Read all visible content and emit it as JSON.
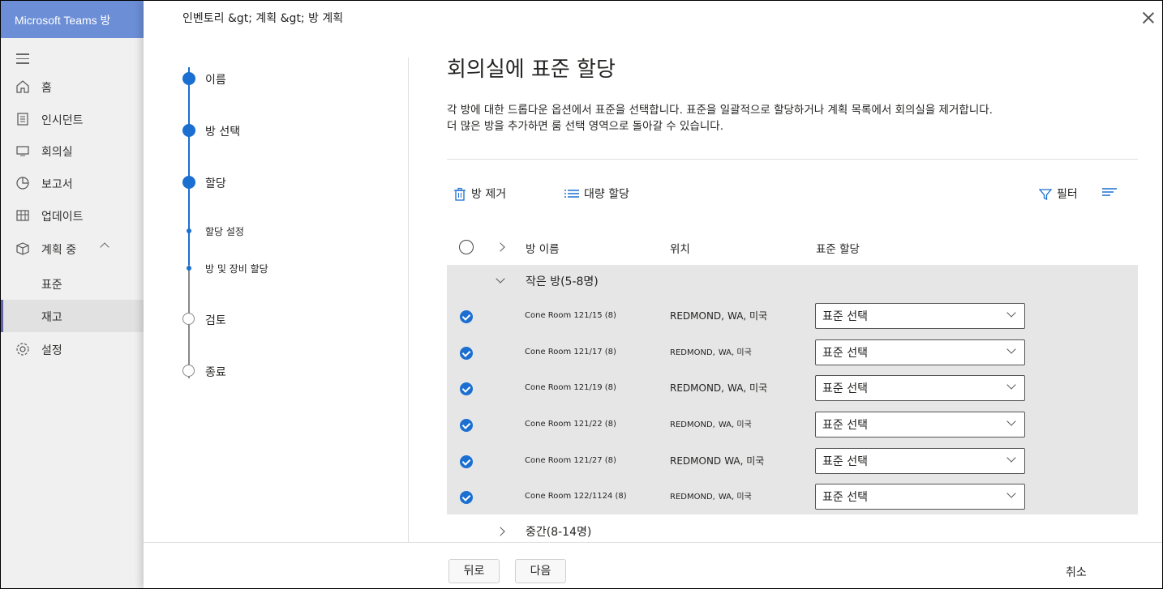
{
  "app": {
    "title": "Microsoft Teams 방",
    "nav": {
      "home": "홈",
      "incidents": "인시던트",
      "rooms": "회의실",
      "reports": "보고서",
      "updates": "업데이트",
      "planning": "계획 중",
      "standards": "표준",
      "inventory": "재고",
      "settings": "설정"
    }
  },
  "dialog": {
    "breadcrumb": "인벤토리 &gt; 계획 &gt;  방 계획",
    "steps": [
      {
        "label": "이름",
        "state": "done"
      },
      {
        "label": "방 선택",
        "state": "done"
      },
      {
        "label": "할당",
        "state": "current"
      },
      {
        "label": "할당 설정",
        "state": "sub"
      },
      {
        "label": "방 및 장비 할당",
        "state": "sub"
      },
      {
        "label": "검토",
        "state": "todo"
      },
      {
        "label": "종료",
        "state": "todo"
      }
    ],
    "heading": "회의실에 표준 할당",
    "description_line1": "각 방에 대한 드롭다운 옵션에서 표준을 선택합니다. 표준을 일괄적으로 할당하거나 계획 목록에서 회의실을 제거합니다.",
    "description_line2": "더 많은 방을 추가하면 룸 선택 영역으로 돌아갈 수 있습니다.",
    "toolbar": {
      "remove": "방 제거",
      "bulk_assign": "대량 할당",
      "filter": "필터"
    },
    "table": {
      "headers": {
        "name": "방 이름",
        "location": "위치",
        "standard": "표준 할당"
      },
      "group1": "작은 방(5-8명)",
      "rows": [
        {
          "name": "Cone Room 121/15 (8)",
          "city": "REDMOND,",
          "state": "WA, 미국",
          "standard": "표준 선택"
        },
        {
          "name": "Cone Room 121/17 (8)",
          "city": "REDMOND,",
          "state": "WA, 미국",
          "standard": "표준 선택"
        },
        {
          "name": "Cone Room 121/19 (8)",
          "city": "REDMOND,",
          "state": "WA, 미국",
          "standard": "표준 선택"
        },
        {
          "name": "Cone Room 121/22 (8)",
          "city": "REDMOND,",
          "state": "WA, 미국",
          "standard": "표준 선택"
        },
        {
          "name": "Cone Room 121/27 (8)",
          "city": "REDMOND",
          "state": "WA, 미국",
          "standard": "표준 선택"
        },
        {
          "name": "Cone Room 122/1124 (8)",
          "city": "REDMOND,",
          "state": "WA, 미국",
          "standard": "표준 선택"
        }
      ],
      "group2": "중간(8-14명)"
    },
    "footer": {
      "back": "뒤로",
      "next": "다음",
      "cancel": "취소"
    }
  },
  "colors": {
    "accent": "#1a6fd1",
    "header": "#6b8ed6",
    "brand": "#6264a7"
  }
}
